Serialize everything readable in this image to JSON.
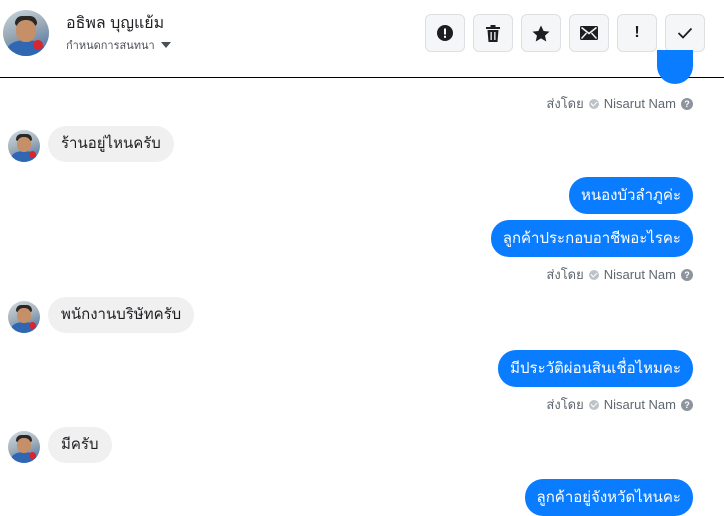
{
  "header": {
    "contact_name": "อธิพล บุญแย้ม",
    "subtitle": "กำหนดการสนทนา"
  },
  "toolbar": {
    "buttons": [
      {
        "name": "report-button",
        "icon": "alert-circle-icon"
      },
      {
        "name": "delete-button",
        "icon": "trash-icon"
      },
      {
        "name": "star-button",
        "icon": "star-icon"
      },
      {
        "name": "mark-unread-button",
        "icon": "envelope-icon"
      },
      {
        "name": "important-button",
        "icon": "exclamation-icon",
        "text": "!"
      },
      {
        "name": "done-button",
        "icon": "check-icon"
      }
    ]
  },
  "messages": [
    {
      "side": "right",
      "text": "",
      "partial": true
    },
    {
      "side": "meta",
      "label": "ส่งโดย",
      "sender": "Nisarut Nam"
    },
    {
      "side": "left",
      "text": "ร้านอยู่ไหนครับ"
    },
    {
      "side": "right",
      "text": "หนองบัวลำภูค่ะ"
    },
    {
      "side": "right",
      "text": "ลูกค้าประกอบอาชีพอะไรคะ"
    },
    {
      "side": "meta",
      "label": "ส่งโดย",
      "sender": "Nisarut Nam"
    },
    {
      "side": "left",
      "text": "พนักงานบริษัทครับ"
    },
    {
      "side": "right",
      "text": "มีประวัติผ่อนสินเชื่อไหมคะ"
    },
    {
      "side": "meta",
      "label": "ส่งโดย",
      "sender": "Nisarut Nam"
    },
    {
      "side": "left",
      "text": "มีครับ"
    },
    {
      "side": "right",
      "text": "ลูกค้าอยู่จังหวัดไหนคะ"
    }
  ],
  "colors": {
    "outgoing_bubble": "#0a7cff",
    "incoming_bubble": "#f0f0f0",
    "meta_text": "#606770"
  }
}
